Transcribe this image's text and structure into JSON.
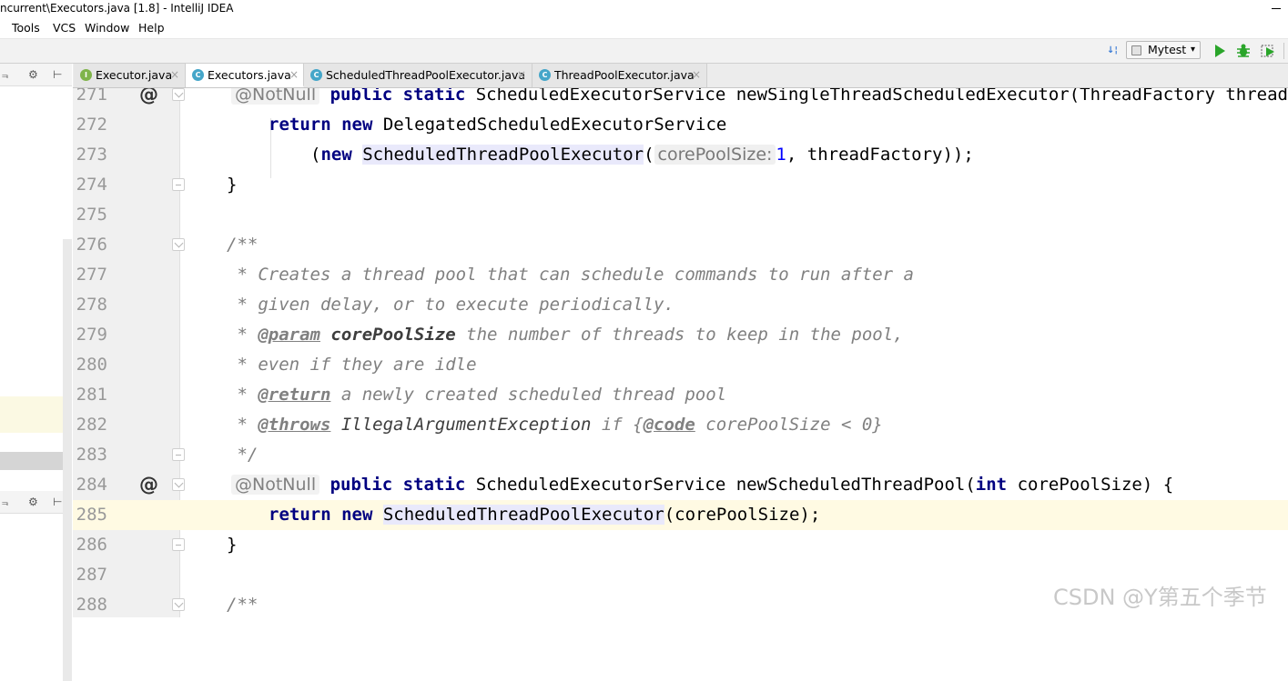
{
  "window": {
    "title": "ncurrent\\Executors.java [1.8] - IntelliJ IDEA"
  },
  "menu": [
    "Tools",
    "VCS",
    "Window",
    "Help"
  ],
  "toolbar": {
    "run_config": "Mytest"
  },
  "left_panel": {
    "tool_glyphs": [
      "⫬",
      "⚙",
      "⊢"
    ]
  },
  "tabs": [
    {
      "label": "Executor.java",
      "icon": "I",
      "active": false
    },
    {
      "label": "Executors.java",
      "icon": "C",
      "active": true
    },
    {
      "label": "ScheduledThreadPoolExecutor.java",
      "icon": "C",
      "active": false
    },
    {
      "label": "ThreadPoolExecutor.java",
      "icon": "C",
      "active": false
    }
  ],
  "tab_close_glyph": "×",
  "editor": {
    "current_line": "285",
    "lines": [
      {
        "n": "271",
        "gutter": "@",
        "fold": "open"
      },
      {
        "n": "272"
      },
      {
        "n": "273"
      },
      {
        "n": "274",
        "fold": "close"
      },
      {
        "n": "275"
      },
      {
        "n": "276",
        "fold": "open"
      },
      {
        "n": "277"
      },
      {
        "n": "278"
      },
      {
        "n": "279"
      },
      {
        "n": "280"
      },
      {
        "n": "281"
      },
      {
        "n": "282"
      },
      {
        "n": "283",
        "fold": "close"
      },
      {
        "n": "284",
        "gutter": "@",
        "fold": "open"
      },
      {
        "n": "285"
      },
      {
        "n": "286",
        "fold": "close"
      },
      {
        "n": "287"
      },
      {
        "n": "288",
        "fold": "open"
      }
    ],
    "code": {
      "l271_ann": "@NotNull",
      "l271_kw": "public static",
      "l271_rest": " ScheduledExecutorService newSingleThreadScheduledExecutor(ThreadFactory threadFactory) {",
      "l272_kw": "return new",
      "l272_rest": " DelegatedScheduledExecutorService",
      "l273_open": "(",
      "l273_kw": "new",
      "l273_cls": "ScheduledThreadPoolExecutor",
      "l273_paren": "(",
      "l273_hint": "corePoolSize:",
      "l273_num": "1",
      "l273_rest": ", threadFactory));",
      "l274": "}",
      "l276": "/**",
      "l277": " * Creates a thread pool that can schedule commands to run after a",
      "l278": " * given delay, or to execute periodically.",
      "l279_star": " * ",
      "l279_tag": "@param",
      "l279_param": "corePoolSize",
      "l279_rest": " the number of threads to keep in the pool,",
      "l280": " * even if they are idle",
      "l281_star": " * ",
      "l281_tag": "@return",
      "l281_rest": " a newly created scheduled thread pool",
      "l282_star": " * ",
      "l282_tag": "@throws",
      "l282_ex": "IllegalArgumentException",
      "l282_if": " if {",
      "l282_code": "@code",
      "l282_rest": " corePoolSize < 0}",
      "l283": " */",
      "l284_ann": "@NotNull",
      "l284_kw1": "public static",
      "l284_mid": " ScheduledExecutorService newScheduledThreadPool(",
      "l284_kw2": "int",
      "l284_rest": " corePoolSize) {",
      "l285_kw": "return new",
      "l285_cls": "ScheduledThreadPoolExecutor",
      "l285_rest": "(corePoolSize);",
      "l286": "}",
      "l288": "/**"
    }
  },
  "watermark": "CSDN @Y第五个季节",
  "colors": {
    "keyword": "#000080",
    "comment": "#808080",
    "number": "#0000ff",
    "current_line": "#fffae3",
    "run": "#2aa52a"
  }
}
